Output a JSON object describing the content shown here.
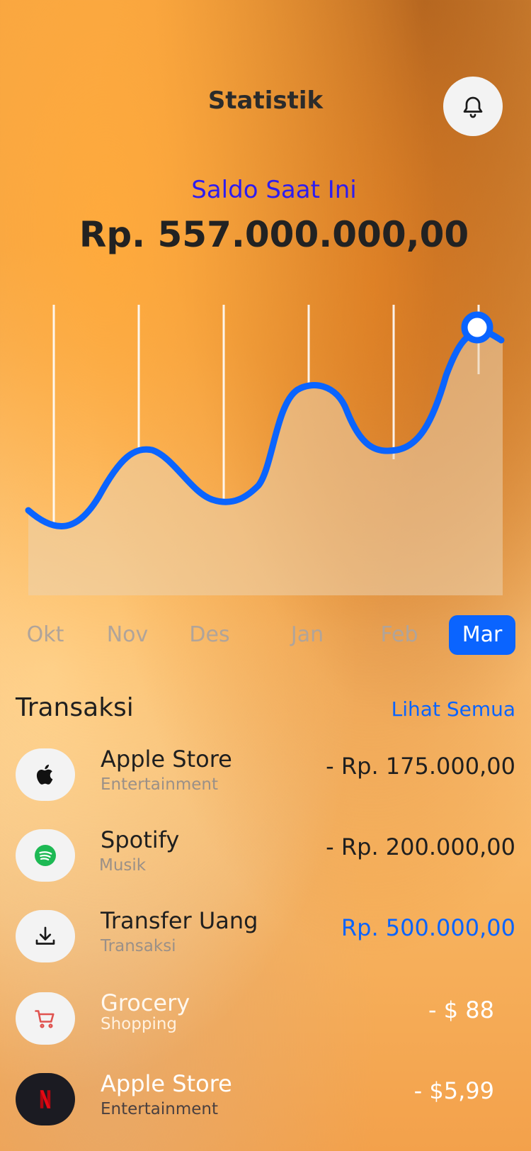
{
  "header": {
    "title": "Statistik"
  },
  "balance": {
    "label": "Saldo Saat Ini",
    "value": "Rp. 557.000.000,00"
  },
  "months": [
    "Okt",
    "Nov",
    "Des",
    "Jan",
    "Feb",
    "Mar"
  ],
  "selected_month": "Mar",
  "colors": {
    "accent": "#0a64ff",
    "saldo_label": "#2d1cf0",
    "text_dark": "#1f1f1f",
    "muted": "#9a9088"
  },
  "transactions_section": {
    "title": "Transaksi",
    "see_all": "Lihat Semua"
  },
  "transactions": [
    {
      "name": "Apple Store",
      "category": "Entertainment",
      "amount": "- Rp. 175.000,00",
      "icon": "apple-icon"
    },
    {
      "name": "Spotify",
      "category": "Musik",
      "amount": "- Rp. 200.000,00",
      "icon": "spotify-icon"
    },
    {
      "name": "Transfer Uang",
      "category": "Transaksi",
      "amount": "Rp. 500.000,00",
      "icon": "download-icon"
    },
    {
      "name": "Grocery",
      "category": "Shopping",
      "amount": "- $ 88",
      "icon": "cart-icon"
    },
    {
      "name": "Apple Store",
      "category": "Entertainment",
      "amount": "- $5,99",
      "icon": "netflix-icon"
    }
  ]
}
